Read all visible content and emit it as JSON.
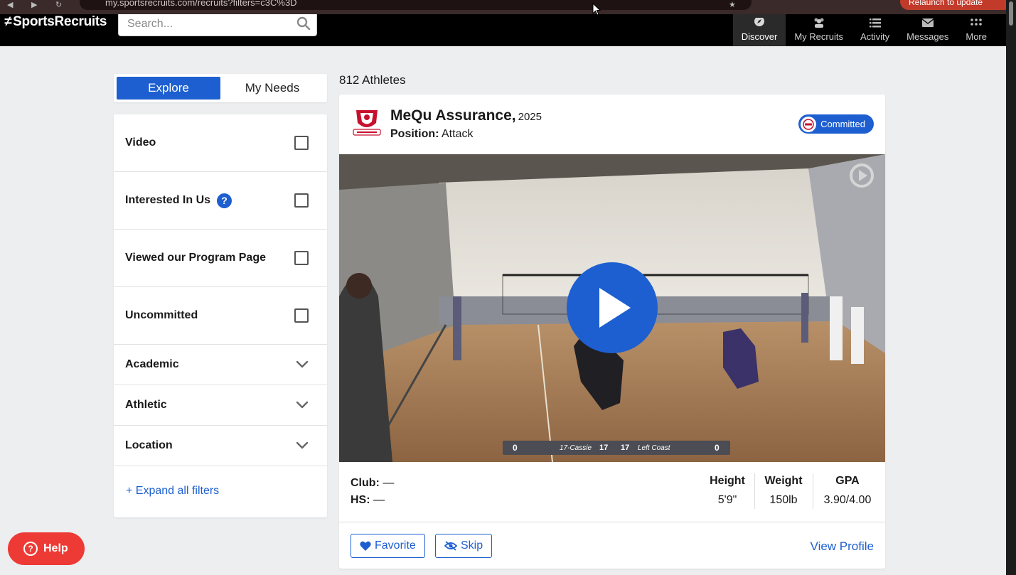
{
  "browser": {
    "url": "my.sportsrecruits.com/recruits?filters=c3C%3D",
    "relaunch_label": "Relaunch to update"
  },
  "header": {
    "logo": "SportsRecruits",
    "search_placeholder": "Search...",
    "nav": [
      {
        "label": "Discover",
        "icon": "compass-icon",
        "active": true
      },
      {
        "label": "My Recruits",
        "icon": "people-icon",
        "active": false
      },
      {
        "label": "Activity",
        "icon": "list-icon",
        "active": false
      },
      {
        "label": "Messages",
        "icon": "mail-icon",
        "active": false
      },
      {
        "label": "More",
        "icon": "grid-icon",
        "active": false
      }
    ]
  },
  "sidebar": {
    "tabs": {
      "explore": "Explore",
      "my_needs": "My Needs"
    },
    "filters": {
      "video": "Video",
      "interested": "Interested In Us",
      "interested_help": "?",
      "viewed": "Viewed our Program Page",
      "uncommitted": "Uncommitted",
      "academic": "Academic",
      "athletic": "Athletic",
      "location": "Location"
    },
    "expand_all": "+ Expand all filters"
  },
  "main": {
    "count": "812 Athletes",
    "athlete": {
      "name": "MeQu Assurance,",
      "grad_year": "2025",
      "position_label": "Position:",
      "position": "Attack",
      "status": "Committed",
      "club_label": "Club:",
      "club": "—",
      "hs_label": "HS:",
      "hs": "—",
      "stats": [
        {
          "label": "Height",
          "value": "5'9\""
        },
        {
          "label": "Weight",
          "value": "150lb"
        },
        {
          "label": "GPA",
          "value": "3.90/4.00"
        }
      ]
    },
    "video": {
      "scoreboard": {
        "left_score": "0",
        "left_team": "17-Cassie",
        "set_left": "17",
        "set_right": "17",
        "right_team": "Left Coast",
        "right_score": "0"
      }
    },
    "actions": {
      "favorite": "Favorite",
      "skip": "Skip",
      "view_profile": "View Profile"
    }
  },
  "help_button": "Help",
  "colors": {
    "brand_blue": "#1d5fd0",
    "help_red": "#ee3a35",
    "header_black": "#000000"
  }
}
